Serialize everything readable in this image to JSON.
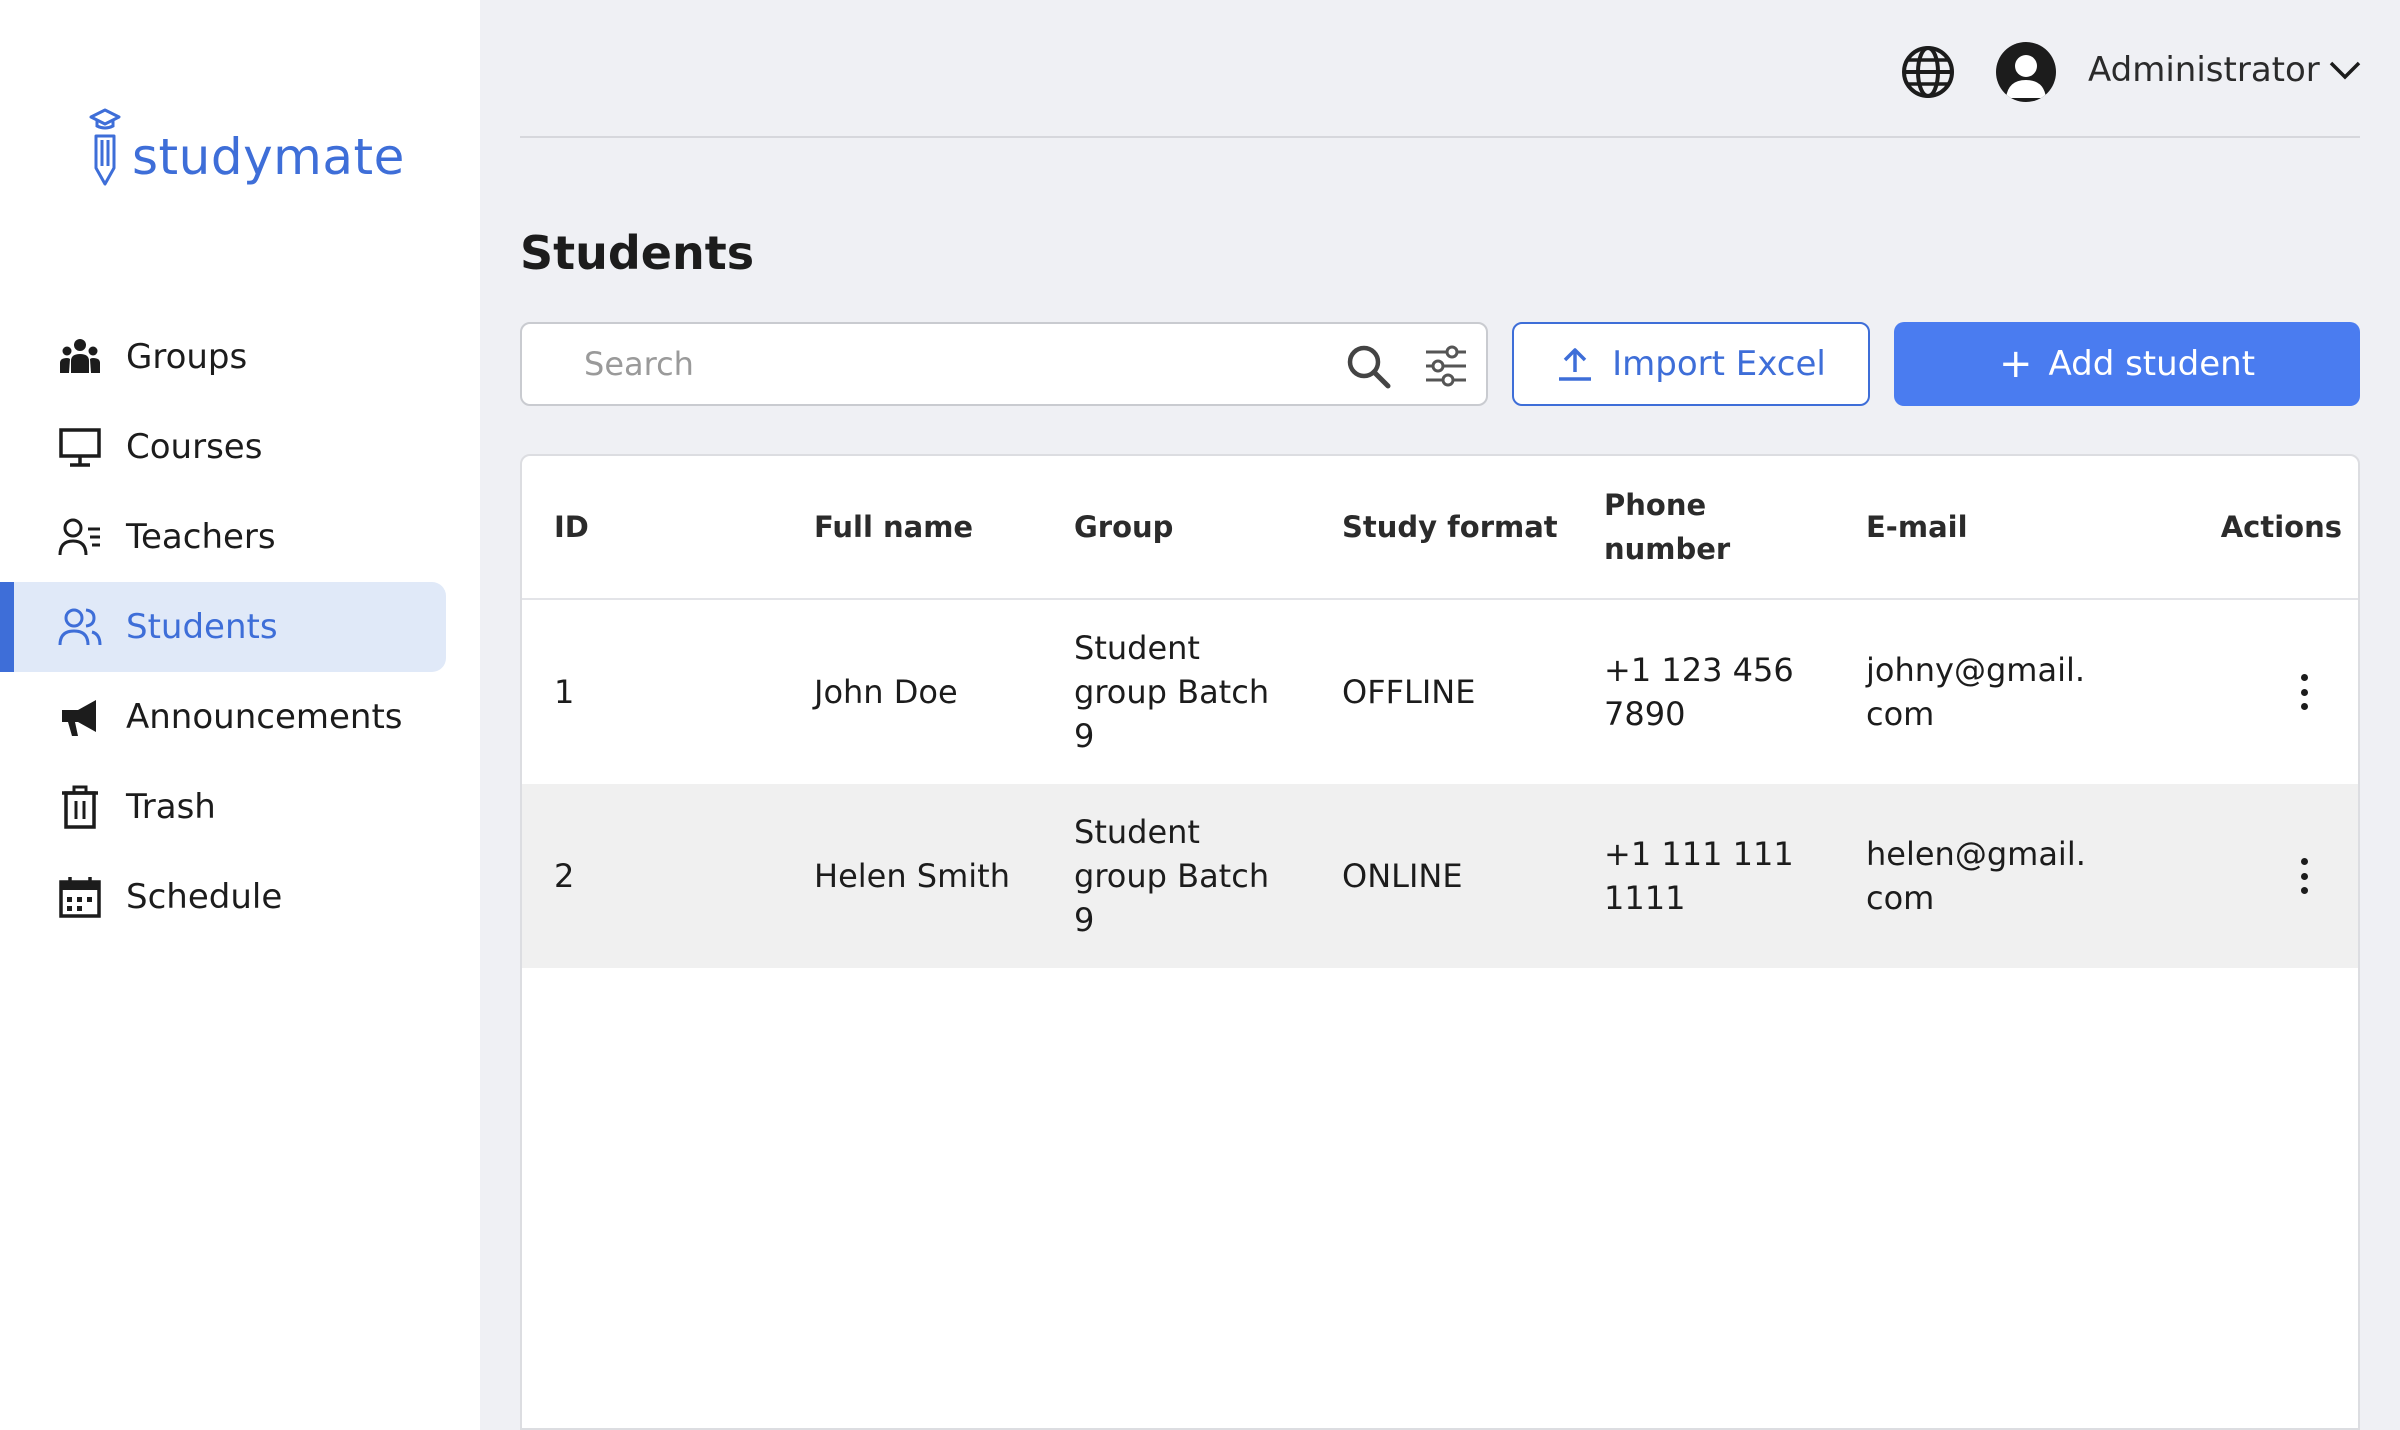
{
  "brand": {
    "name": "studymate",
    "color": "#3e6ed8"
  },
  "sidebar": {
    "items": [
      {
        "label": "Groups",
        "icon": "groups-icon"
      },
      {
        "label": "Courses",
        "icon": "monitor-icon"
      },
      {
        "label": "Teachers",
        "icon": "teacher-icon"
      },
      {
        "label": "Students",
        "icon": "students-icon",
        "active": true
      },
      {
        "label": "Announcements",
        "icon": "megaphone-icon"
      },
      {
        "label": "Trash",
        "icon": "trash-icon"
      },
      {
        "label": "Schedule",
        "icon": "calendar-icon"
      }
    ]
  },
  "header": {
    "user_name": "Administrator",
    "icons": [
      "globe-icon",
      "avatar",
      "chevron-down-icon"
    ]
  },
  "page": {
    "title": "Students",
    "search": {
      "placeholder": "Search",
      "value": ""
    },
    "import_button": "Import Excel",
    "add_button": "Add student",
    "add_button_plus": "+"
  },
  "table": {
    "columns": [
      "ID",
      "Full name",
      "Group",
      "Study format",
      "Phone number",
      "E-mail",
      "Actions"
    ],
    "rows": [
      {
        "id": "1",
        "full_name": "John Doe",
        "group": "Student group Batch 9",
        "study_format": "OFFLINE",
        "phone": "+1 123 456 7890",
        "email": "johny@gmail.com"
      },
      {
        "id": "2",
        "full_name": "Helen Smith",
        "group": "Student group Batch 9",
        "study_format": "ONLINE",
        "phone": "+1 111 111 1111",
        "email": "helen@gmail.com"
      }
    ]
  },
  "colors": {
    "accent": "#3e6ed8",
    "primary_button": "#4a7cf0",
    "background": "#eff0f4",
    "active_nav_bg": "#e0e9f8"
  }
}
